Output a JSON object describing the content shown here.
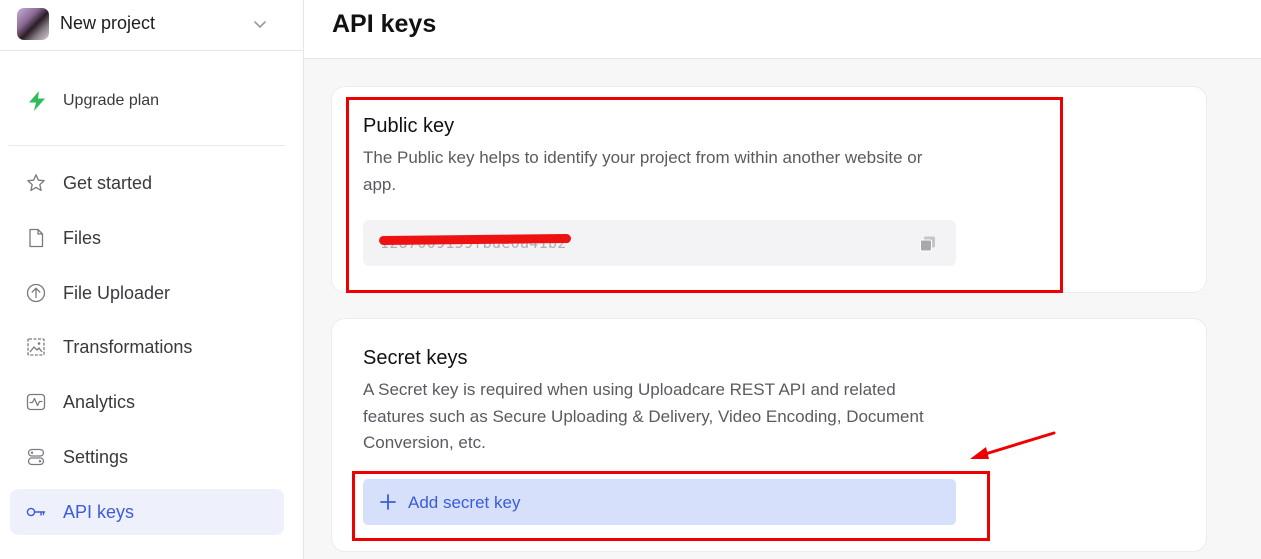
{
  "sidebar": {
    "project_name": "New project",
    "upgrade_label": "Upgrade plan",
    "items": [
      {
        "label": "Get started",
        "icon": "star-icon"
      },
      {
        "label": "Files",
        "icon": "file-icon"
      },
      {
        "label": "File Uploader",
        "icon": "upload-icon"
      },
      {
        "label": "Transformations",
        "icon": "image-transform-icon"
      },
      {
        "label": "Analytics",
        "icon": "analytics-icon"
      },
      {
        "label": "Settings",
        "icon": "settings-icon"
      },
      {
        "label": "API keys",
        "icon": "key-icon",
        "active": true
      }
    ]
  },
  "header": {
    "title": "API keys"
  },
  "public_key": {
    "title": "Public key",
    "description": "The Public key helps to identify your project from within another website or app.",
    "value": "1287009159fbde0a41b2"
  },
  "secret_keys": {
    "title": "Secret keys",
    "description": "A Secret key is required when using Uploadcare REST API and related features such as Secure Uploading & Delivery, Video Encoding, Document Conversion, etc.",
    "add_button_label": "Add secret key"
  },
  "colors": {
    "accent": "#3b5bdb",
    "active_bg": "#eef1fc",
    "button_bg": "#d6e0fb",
    "upgrade_green": "#2ebd59",
    "annotation_red": "#ee0000"
  }
}
